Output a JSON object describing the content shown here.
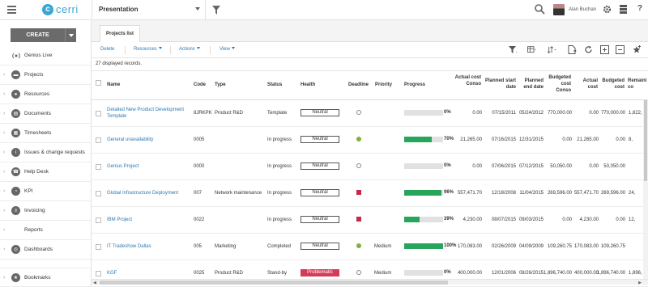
{
  "app": {
    "logo_text": "cerri",
    "logo_mark": "c"
  },
  "topbar": {
    "presentation_label": "Presentation",
    "username": "Alan Buchan",
    "help_label": "?"
  },
  "sidebar": {
    "create_label": "CREATE",
    "items": [
      {
        "label": "Genius Live",
        "icon": "radio-icon",
        "chevron": false
      },
      {
        "label": "Projects",
        "icon": "folder-icon",
        "chevron": true
      },
      {
        "label": "Resources",
        "icon": "person-icon",
        "chevron": true
      },
      {
        "label": "Documents",
        "icon": "document-icon",
        "chevron": true
      },
      {
        "label": "Timesheets",
        "icon": "timesheet-icon",
        "chevron": true
      },
      {
        "label": "Issues & change requests",
        "icon": "info-icon",
        "chevron": true
      },
      {
        "label": "Help Desk",
        "icon": "helpdesk-icon",
        "chevron": true
      },
      {
        "label": "KPI",
        "icon": "kpi-icon",
        "chevron": true
      },
      {
        "label": "Invoicing",
        "icon": "invoice-icon",
        "chevron": true
      },
      {
        "label": "Reports",
        "icon": "none",
        "chevron": true
      },
      {
        "label": "Dashboards",
        "icon": "dashboard-icon",
        "chevron": true
      },
      {
        "label": "Bookmarks",
        "icon": "star-icon",
        "chevron": true
      }
    ]
  },
  "main": {
    "tab_label": "Projects list",
    "toolbar": {
      "delete": "Delete",
      "resources": "Resources",
      "actions": "Actions",
      "view": "View"
    },
    "records_text": "27 displayed records.",
    "columns": {
      "name": "Name",
      "code": "Code",
      "type": "Type",
      "status": "Status",
      "health": "Health",
      "deadline": "Deadline",
      "priority": "Priority",
      "progress": "Progress",
      "actual_cost_conso": "Actual cost Conso",
      "planned_start": "Planned start date",
      "planned_end": "Planned end date",
      "budgeted_cost_conso": "Budgeted cost Conso",
      "actual_cost": "Actual cost",
      "budgeted_cost": "Budgeted cost",
      "remaining": "Remaini co"
    },
    "rows": [
      {
        "name": "Detailed New Product Development Template",
        "code": "8JRKPK",
        "type": "Product R&D",
        "status": "Template",
        "health": "Neutral",
        "deadline": "none",
        "priority": "",
        "progress": 0,
        "progress_label": "0%",
        "actual_cost_conso": "0.00",
        "planned_start": "07/15/2011",
        "planned_end": "05/24/2012",
        "budgeted_cost_conso": "770,000.00",
        "actual_cost": "0.00",
        "budgeted_cost": "770,000.00",
        "remaining": "1,822,"
      },
      {
        "name": "General unavailability",
        "code": "0005",
        "type": "",
        "status": "In progress",
        "health": "Neutral",
        "deadline": "green",
        "priority": "",
        "progress": 70,
        "progress_label": "70%",
        "actual_cost_conso": "21,265.00",
        "planned_start": "07/16/2015",
        "planned_end": "12/31/2015",
        "budgeted_cost_conso": "0.00",
        "actual_cost": "21,265.00",
        "budgeted_cost": "0.00",
        "remaining": "8,"
      },
      {
        "name": "Genius Project",
        "code": "0000",
        "type": "",
        "status": "In progress",
        "health": "Neutral",
        "deadline": "none",
        "priority": "",
        "progress": 0,
        "progress_label": "0%",
        "actual_cost_conso": "0.00",
        "planned_start": "07/06/2015",
        "planned_end": "07/12/2015",
        "budgeted_cost_conso": "50,050.00",
        "actual_cost": "0.00",
        "budgeted_cost": "50,050.00",
        "remaining": ""
      },
      {
        "name": "Global Infrastructure Deployment",
        "code": "007",
        "type": "Network maintenance",
        "status": "In progress",
        "health": "Neutral",
        "deadline": "red",
        "priority": "",
        "progress": 96,
        "progress_label": "96%",
        "actual_cost_conso": "557,471.70",
        "planned_start": "12/18/2008",
        "planned_end": "11/04/2015",
        "budgeted_cost_conso": "269,596.00",
        "actual_cost": "557,471.70",
        "budgeted_cost": "269,596.00",
        "remaining": "24,"
      },
      {
        "name": "IBM Project",
        "code": "0022",
        "type": "",
        "status": "In progress",
        "health": "Neutral",
        "deadline": "red",
        "priority": "",
        "progress": 39,
        "progress_label": "39%",
        "actual_cost_conso": "4,230.00",
        "planned_start": "08/07/2015",
        "planned_end": "09/03/2015",
        "budgeted_cost_conso": "0.00",
        "actual_cost": "4,230.00",
        "budgeted_cost": "0.00",
        "remaining": "12,"
      },
      {
        "name": "IT Tradeshow Dallas",
        "code": "005",
        "type": "Marketing",
        "status": "Completed",
        "health": "Neutral",
        "deadline": "green",
        "priority": "Medium",
        "progress": 100,
        "progress_label": "100%",
        "actual_cost_conso": "170,083.00",
        "planned_start": "02/26/2009",
        "planned_end": "04/09/2009",
        "budgeted_cost_conso": "109,260.75",
        "actual_cost": "170,083.00",
        "budgeted_cost": "109,260.75",
        "remaining": ""
      },
      {
        "name": "KGF",
        "code": "0025",
        "type": "Product R&D",
        "status": "Stand-by",
        "health": "Problematic",
        "deadline": "none",
        "priority": "Medium",
        "progress": 0,
        "progress_label": "0%",
        "actual_cost_conso": "400,000.00",
        "planned_start": "12/01/2006",
        "planned_end": "08/26/2015",
        "budgeted_cost_conso": "1,896,740.00",
        "actual_cost": "400,000.00",
        "budgeted_cost": "1,896,740.00",
        "remaining": "1,896,"
      }
    ]
  },
  "colors": {
    "accent": "#2a7ab8",
    "progress": "#27a55c",
    "problematic": "#d73a56",
    "deadline_green": "#7db33d",
    "deadline_red": "#c62a4a",
    "logo": "#3aa7d6"
  }
}
